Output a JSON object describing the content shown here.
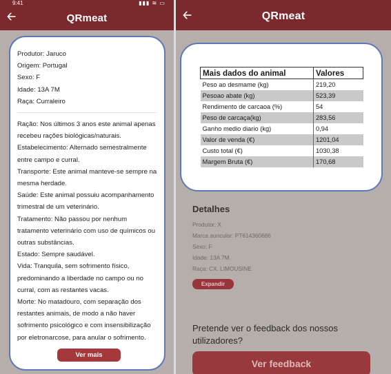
{
  "status_bar": {
    "time": "9:41",
    "icons": "▮▮▮ ≋ ▭"
  },
  "left_screen": {
    "title": "QRmeat",
    "animal_info": [
      "Produtor: Jaruco",
      "Origem: Portugal",
      "Sexo: F",
      "Idade: 13A 7M",
      "Raça: Curraleiro"
    ],
    "details": [
      "Ração: Nos últimos 3 anos este animal apenas recebeu rações biológicas/naturais.",
      "Estabelecimento: Alternado semestralmente entre campo e curral.",
      "Transporte: Este animal manteve-se sempre na mesma herdade.",
      "Saúde: Este animal possuiu acompanhamento trimestral de um veterinário.",
      "Tratamento: Não passou por nenhum tratamento veterinário com uso de químicos ou outras substâncias.",
      "Estado: Sempre saudável.",
      "Vida: Tranquila, sem sofrimento físico, predominando a liberdade no campo ou no curral, com as restantes vacas.",
      "Morte: No matadouro, com separação dos restantes animais, de modo a não haver sofrimento psicológico e com insensibilização por eletronarcose, para anular o sofrimento."
    ],
    "ver_mais_label": "Ver mais"
  },
  "right_screen": {
    "title": "QRmeat",
    "table": {
      "header": [
        "Mais dados do animal",
        "Valores"
      ],
      "rows": [
        [
          "Peso ao desmame (kg)",
          "219,20"
        ],
        [
          "Pesoao abate (kg)",
          "523,39"
        ],
        [
          "Rendimento de carcaoa (%)",
          "54"
        ],
        [
          "Peso de carcaça(kg)",
          "283,56"
        ],
        [
          "Ganho medio diario (kg)",
          "0,94"
        ],
        [
          "Valor de venda (€)",
          "1201,04"
        ],
        [
          "Custo total (€)",
          "1030,38"
        ],
        [
          "Margem Bruta (€)",
          "170,68"
        ]
      ]
    },
    "detalhes_title": "Detalhes",
    "detalhes_lines": [
      "Produtor: X",
      "Marca auricular: PT614360686",
      "Sexo: F",
      "Idade: 13A 7M",
      "Raça: CX. LIMOUSINE"
    ],
    "expandir_label": "Expandir",
    "feedback_question": "Pretende ver o feedback dos nossos utilizadores?",
    "feedback_button_label": "Ver feedback"
  },
  "colors": {
    "topbar": "#7a2a2d",
    "button": "#a5383d",
    "modal_border": "#5d79b8",
    "overlay": "#b5aeab"
  }
}
